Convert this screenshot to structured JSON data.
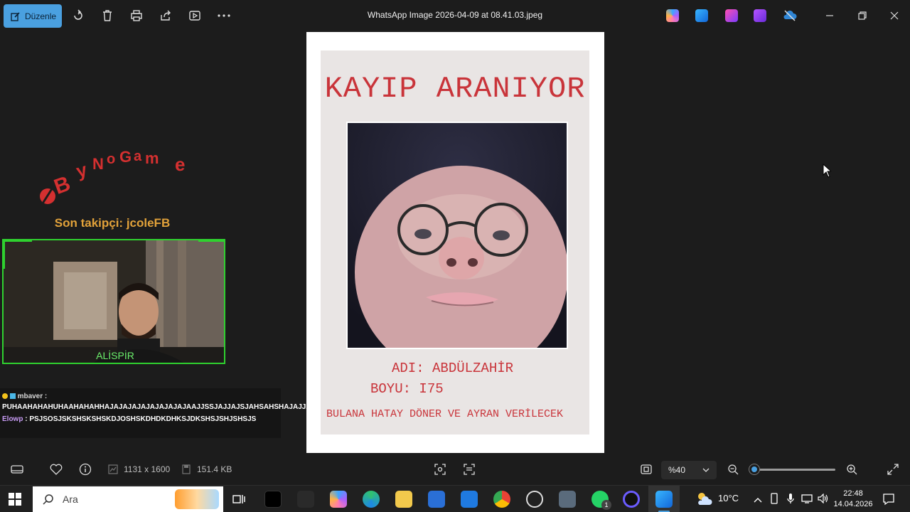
{
  "app": {
    "title": "WhatsApp Image 2026-04-09 at 08.41.03.jpeg",
    "edit_label": "Düzenle",
    "accent": "#4aa0e0"
  },
  "toolbar_icons": [
    "rotate-icon",
    "delete-icon",
    "print-icon",
    "share-icon",
    "slideshow-icon",
    "more-icon"
  ],
  "stream": {
    "logo_text": "ByNoGame",
    "follower_label": "Son takipçi: jcoleFB",
    "cam_name": "ALİSPİR",
    "chat": [
      {
        "user": "mbaver",
        "separator": " :",
        "text": "PUHAAHAHAHUHAAHAHAHHAJAJAJAJAJAJAJAJAJAAJJSSJAJJAJSJAHSAHSHAJAJJAHAAJA"
      },
      {
        "user": "Elowp",
        "separator": " :",
        "text": "PSJSOSJSKSHSKSHSKDJOSHSKDHDKDHKSJDKSHSJSHJSHSJS"
      }
    ]
  },
  "poster": {
    "title": "KAYIP ARANIYOR",
    "name_line": "ADI: ABDÜLZAHİR",
    "height_line": "BOYU: I75",
    "reward_line": "BULANA HATAY DÖNER VE AYRAN VERİLECEK",
    "title_color": "#c9343a"
  },
  "status": {
    "dimensions": "1131 x 1600",
    "size": "151.4 KB",
    "zoom": "%40",
    "zoom_level_fraction": 0.05
  },
  "taskbar": {
    "search_placeholder": "Ara",
    "weather": "10°C",
    "time": "22:48",
    "date": "14.04.2026",
    "whatsapp_badge": "1"
  }
}
